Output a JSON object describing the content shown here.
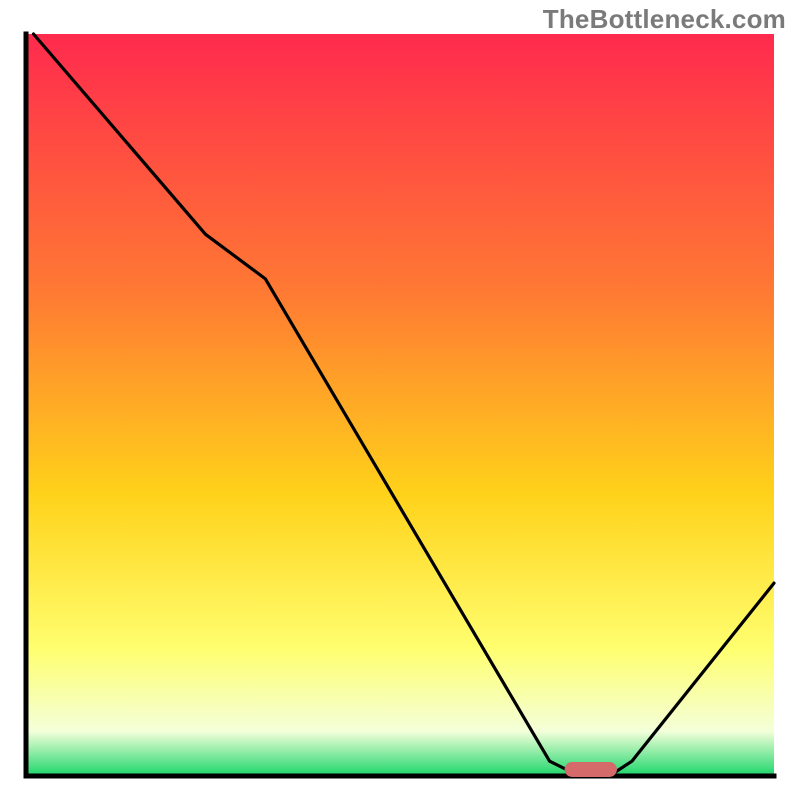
{
  "watermark": "TheBottleneck.com",
  "colors": {
    "gradient_top": "#ff2a4d",
    "gradient_mid1": "#ff7a33",
    "gradient_mid2": "#ffd21a",
    "gradient_mid3": "#ffff70",
    "gradient_mid4": "#f3ffd9",
    "gradient_bottom": "#1bd66a",
    "curve": "#000000",
    "marker_fill": "#d46a6a",
    "axis": "#000000"
  },
  "chart_data": {
    "type": "line",
    "title": "",
    "xlabel": "",
    "ylabel": "",
    "xlim": [
      0,
      100
    ],
    "ylim": [
      0,
      100
    ],
    "x": [
      1,
      24,
      32,
      70,
      74,
      78,
      81,
      100
    ],
    "values": [
      100,
      73,
      67,
      2,
      0,
      0,
      2,
      26
    ],
    "optimal_marker": {
      "x_start": 72,
      "x_end": 79,
      "y": 0
    },
    "grid": false,
    "legend": false
  }
}
